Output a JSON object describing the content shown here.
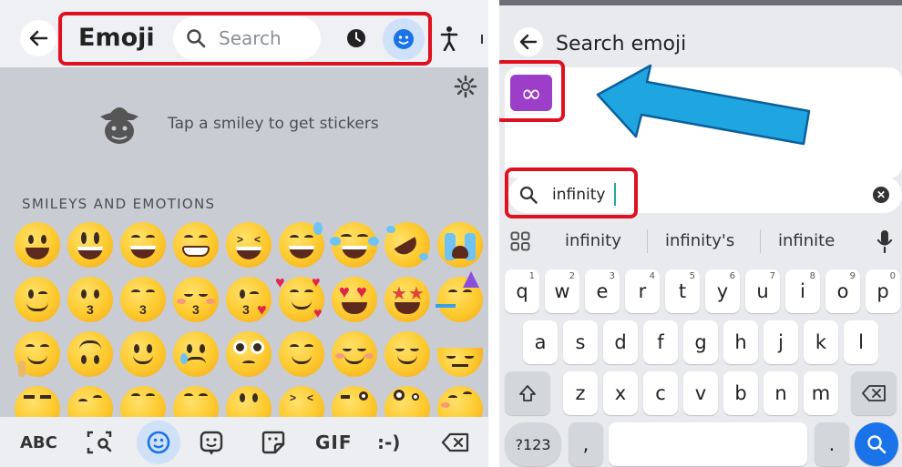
{
  "left": {
    "title": "Emoji",
    "search_placeholder": "Search",
    "sticker_prompt": "Tap a smiley to get stickers",
    "section_label": "SMILEYS AND EMOTIONS",
    "bottom_bar": {
      "abc": "ABC",
      "gif": "GIF",
      "emoticon": ":-)"
    }
  },
  "right": {
    "title": "Search emoji",
    "result_emoji": "∞",
    "search_value": "infinity",
    "suggestions": [
      "infinity",
      "infinity's",
      "infinite"
    ],
    "keys_row1": [
      {
        "k": "q",
        "h": "1"
      },
      {
        "k": "w",
        "h": "2"
      },
      {
        "k": "e",
        "h": "3"
      },
      {
        "k": "r",
        "h": "4"
      },
      {
        "k": "t",
        "h": "5"
      },
      {
        "k": "y",
        "h": "6"
      },
      {
        "k": "u",
        "h": "7"
      },
      {
        "k": "i",
        "h": "8"
      },
      {
        "k": "o",
        "h": "9"
      },
      {
        "k": "p",
        "h": "0"
      }
    ],
    "keys_row2": [
      "a",
      "s",
      "d",
      "f",
      "g",
      "h",
      "j",
      "k",
      "l"
    ],
    "keys_row3": [
      "z",
      "x",
      "c",
      "v",
      "b",
      "n",
      "m"
    ],
    "symbols_key": "?123",
    "comma_key": ",",
    "period_key": "."
  },
  "colors": {
    "highlight_box": "#e01020",
    "arrow": "#1fa6e0",
    "accent": "#1a73e8",
    "infinity_tile": "#9c3ec8"
  }
}
